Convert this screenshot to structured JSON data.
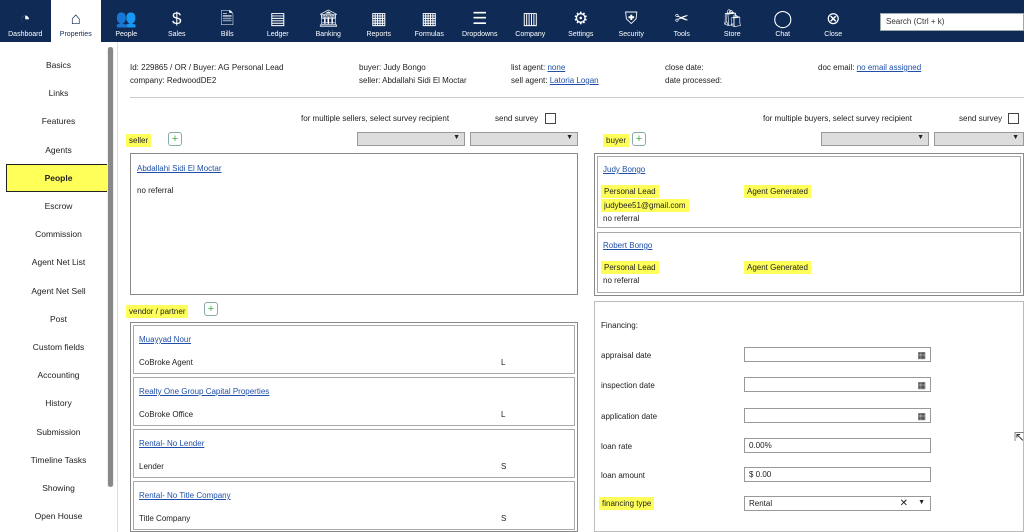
{
  "nav": {
    "items": [
      {
        "label": "Dashboard",
        "icon": "gauge-icon",
        "glyph": "◔"
      },
      {
        "label": "Properties",
        "icon": "home-icon",
        "glyph": "⌂"
      },
      {
        "label": "People",
        "icon": "people-icon",
        "glyph": "👥"
      },
      {
        "label": "Sales",
        "icon": "dollar-icon",
        "glyph": "$"
      },
      {
        "label": "Bills",
        "icon": "bill-icon",
        "glyph": "🗎"
      },
      {
        "label": "Ledger",
        "icon": "ledger-icon",
        "glyph": "▤"
      },
      {
        "label": "Banking",
        "icon": "bank-icon",
        "glyph": "🏛"
      },
      {
        "label": "Reports",
        "icon": "report-icon",
        "glyph": "▦"
      },
      {
        "label": "Formulas",
        "icon": "calculator-icon",
        "glyph": "▦"
      },
      {
        "label": "Dropdowns",
        "icon": "list-icon",
        "glyph": "☰"
      },
      {
        "label": "Company",
        "icon": "building-icon",
        "glyph": "▥"
      },
      {
        "label": "Settings",
        "icon": "gear-icon",
        "glyph": "⚙"
      },
      {
        "label": "Security",
        "icon": "shield-icon",
        "glyph": "⛨"
      },
      {
        "label": "Tools",
        "icon": "tools-icon",
        "glyph": "✂"
      },
      {
        "label": "Store",
        "icon": "bag-icon",
        "glyph": "🛍"
      },
      {
        "label": "Chat",
        "icon": "chat-icon",
        "glyph": "◯"
      },
      {
        "label": "Close",
        "icon": "close-icon",
        "glyph": "⊗"
      }
    ],
    "search_placeholder": "Search (Ctrl + k)"
  },
  "sidebar": {
    "items": [
      "Basics",
      "Links",
      "Features",
      "Agents",
      "People",
      "Escrow",
      "Commission",
      "Agent Net List",
      "Agent Net Sell",
      "Post",
      "Custom fields",
      "Accounting",
      "History",
      "Submission",
      "Timeline Tasks",
      "Showing",
      "Open House"
    ],
    "active": "People"
  },
  "info": {
    "id_line": "Id: 229865 / OR / Buyer: AG Personal Lead",
    "company": "company: RedwoodDE2",
    "buyer": "buyer: Judy Bongo",
    "seller": "seller: Abdallahi Sidi El Moctar",
    "list_agent_label": "list agent:",
    "list_agent_value": "none",
    "sell_agent_label": "sell agent:",
    "sell_agent_value": "Latoria Logan",
    "close_date": "close date:",
    "date_processed": "date processed:",
    "doc_email_label": "doc email:",
    "doc_email_value": "no email assigned"
  },
  "survey": {
    "sellers_text": "for multiple sellers, select survey recipient",
    "buyers_text": "for multiple buyers, select survey recipient",
    "send_survey": "send survey"
  },
  "seller": {
    "label": "seller",
    "name": "Abdallahi Sidi El Moctar",
    "referral": "no referral"
  },
  "vendor": {
    "label": "vendor / partner",
    "items": [
      {
        "name": "Muayyad Nour",
        "role": "CoBroke Agent",
        "code": "L"
      },
      {
        "name": "Realty One Group Capital Properties",
        "role": "CoBroke Office",
        "code": "L"
      },
      {
        "name": "Rental- No Lender",
        "role": "Lender",
        "code": "S"
      },
      {
        "name": "Rental- No Title Company",
        "role": "Title Company",
        "code": "S"
      }
    ]
  },
  "buyer": {
    "label": "buyer",
    "items": [
      {
        "name": "Judy Bongo",
        "lead": "Personal Lead",
        "source": "Agent Generated",
        "email": "judybee51@gmail.com",
        "referral": "no referral"
      },
      {
        "name": "Robert Bongo",
        "lead": "Personal Lead",
        "source": "Agent Generated",
        "email": "",
        "referral": "no referral"
      }
    ]
  },
  "financing": {
    "title": "Financing:",
    "appraisal": "appraisal date",
    "inspection": "inspection date",
    "application": "application date",
    "loan_rate": "loan rate",
    "loan_rate_value": "0.00%",
    "loan_amount": "loan amount",
    "loan_amount_value": "$ 0.00",
    "financing_type": "financing type",
    "financing_type_value": "Rental"
  },
  "colors": {
    "nav_bg": "#0e2a55",
    "highlight": "#ffff5a",
    "link": "#1f4fa8"
  }
}
